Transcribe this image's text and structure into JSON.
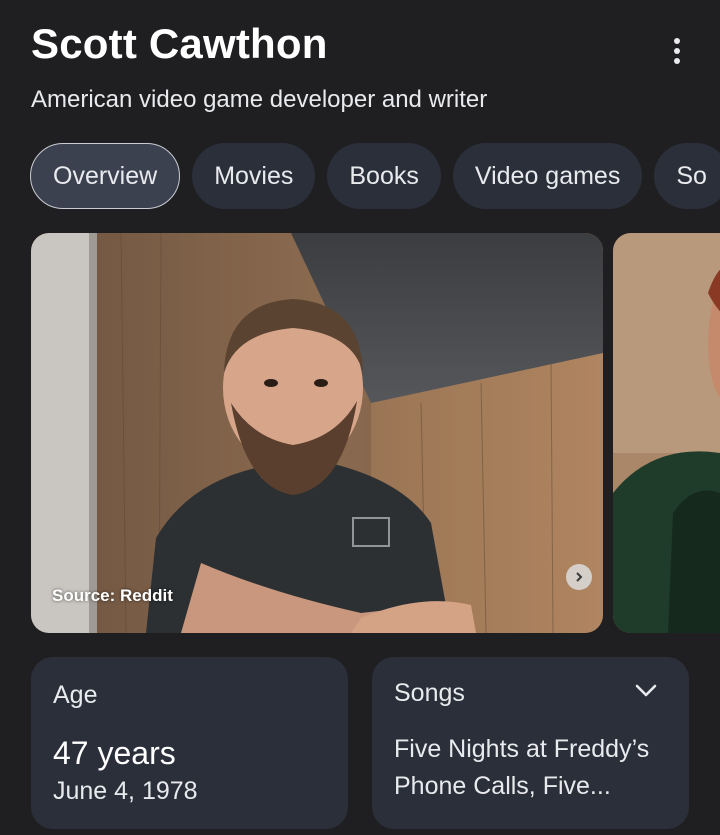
{
  "header": {
    "title": "Scott Cawthon",
    "subtitle": "American video game developer and writer"
  },
  "tabs": [
    {
      "label": "Overview",
      "active": true
    },
    {
      "label": "Movies"
    },
    {
      "label": "Books"
    },
    {
      "label": "Video games"
    },
    {
      "label": "So"
    }
  ],
  "images": {
    "source_label": "Source: Reddit"
  },
  "cards": {
    "age": {
      "label": "Age",
      "value": "47 years",
      "birthdate": "June 4, 1978"
    },
    "songs": {
      "label": "Songs",
      "text": "Five Nights at Freddy’s Phone Calls, Five..."
    }
  },
  "colors": {
    "background": "#1f1f21",
    "chip": "#2b2f3a",
    "chip_active": "#3c4150"
  }
}
